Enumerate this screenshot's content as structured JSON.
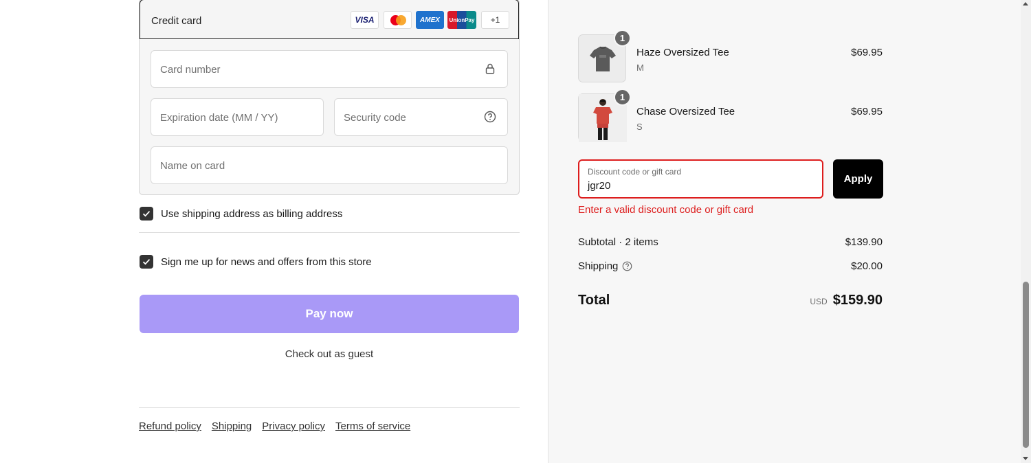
{
  "payment": {
    "method_label": "Credit card",
    "brands": {
      "visa": "VISA",
      "amex": "AMEX",
      "unionpay": "UnionPay",
      "more": "+1"
    },
    "card_number_placeholder": "Card number",
    "expiration_placeholder": "Expiration date (MM / YY)",
    "security_placeholder": "Security code",
    "name_placeholder": "Name on card"
  },
  "checkboxes": {
    "billing_label": "Use shipping address as billing address",
    "billing_checked": true,
    "newsletter_label": "Sign me up for news and offers from this store",
    "newsletter_checked": true
  },
  "actions": {
    "pay_now": "Pay now",
    "guest": "Check out as guest"
  },
  "footer": {
    "links": [
      "Refund policy",
      "Shipping",
      "Privacy policy",
      "Terms of service"
    ]
  },
  "cart": {
    "items": [
      {
        "name": "Haze Oversized Tee",
        "variant": "M",
        "price": "$69.95",
        "quantity": "1"
      },
      {
        "name": "Chase Oversized Tee",
        "variant": "S",
        "price": "$69.95",
        "quantity": "1"
      }
    ]
  },
  "discount": {
    "label": "Discount code or gift card",
    "value": "jgr20",
    "apply": "Apply",
    "error": "Enter a valid discount code or gift card"
  },
  "summary": {
    "subtotal_label": "Subtotal · 2 items",
    "subtotal_value": "$139.90",
    "shipping_label": "Shipping",
    "shipping_value": "$20.00",
    "total_label": "Total",
    "currency": "USD",
    "total_value": "$159.90"
  },
  "colors": {
    "pay_button": "#a999f7",
    "error": "#dd1d1d",
    "apply_button": "#000000"
  }
}
